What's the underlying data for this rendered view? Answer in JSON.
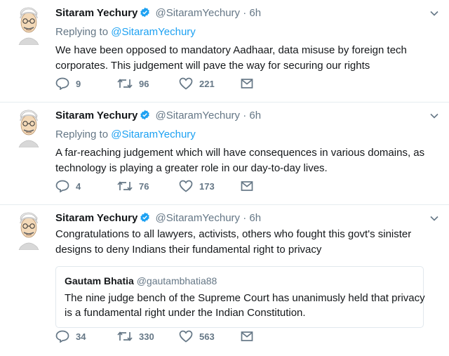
{
  "tweets": [
    {
      "name": "Sitaram Yechury",
      "handle": "@SitaramYechury",
      "dot": "·",
      "time": "6h",
      "replying_prefix": "Replying to",
      "replying_to": "@SitaramYechury",
      "text_line1": "We have been opposed to mandatory Aadhaar, data misuse by foreign tech",
      "text_line2": "corporates. This judgement will pave the way for securing our rights",
      "replies": "9",
      "retweets": "96",
      "likes": "221"
    },
    {
      "name": "Sitaram Yechury",
      "handle": "@SitaramYechury",
      "dot": "·",
      "time": "6h",
      "replying_prefix": "Replying to",
      "replying_to": "@SitaramYechury",
      "text_line1": "A far-reaching judgement which will have consequences in various domains, as",
      "text_line2": "technology is playing a greater role in our day-to-day lives.",
      "replies": "4",
      "retweets": "76",
      "likes": "173"
    },
    {
      "name": "Sitaram Yechury",
      "handle": "@SitaramYechury",
      "dot": "·",
      "time": "6h",
      "text_line1": "Congratulations to all lawyers, activists, others who fought this govt's sinister",
      "text_line2": "designs to deny Indians their fundamental right to privacy",
      "quote": {
        "name": "Gautam Bhatia",
        "handle": "@gautambhatia88",
        "text_line1": "The nine judge bench of the Supreme Court has unanimusly held that privacy",
        "text_line2": "is a fundamental right under the Indian Constitution."
      },
      "replies": "34",
      "retweets": "330",
      "likes": "563"
    }
  ],
  "icons": {
    "verified": "verified-badge-icon",
    "caret": "chevron-down-icon",
    "reply": "reply-icon",
    "retweet": "retweet-icon",
    "like": "heart-icon",
    "message": "envelope-icon"
  },
  "colors": {
    "link": "#1da1f2",
    "muted": "#657786",
    "text": "#14171a",
    "border": "#e6ecf0"
  }
}
